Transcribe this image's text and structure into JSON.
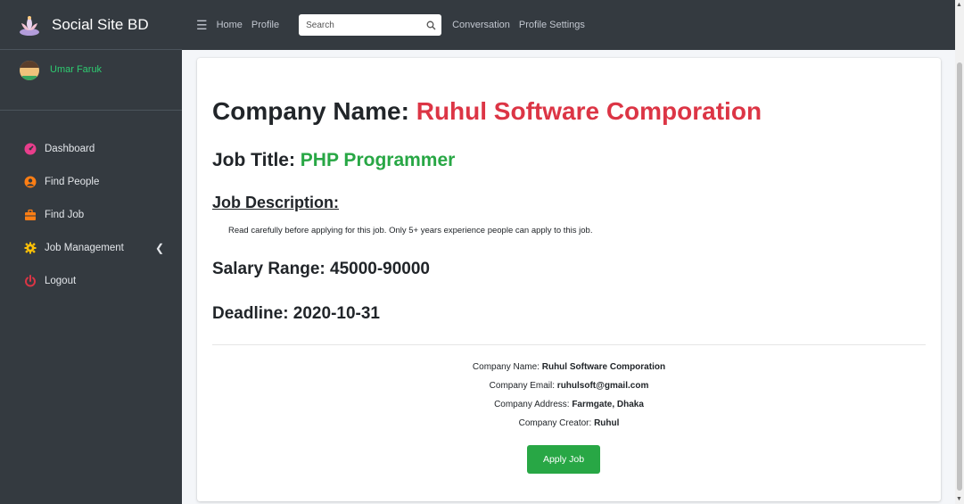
{
  "brand": {
    "title": "Social Site BD",
    "logo_icon": "lotus-logo-icon"
  },
  "user": {
    "name": "Umar Faruk"
  },
  "sidebar": {
    "items": [
      {
        "label": "Dashboard",
        "icon": "dashboard-icon",
        "color": "#e83e8c"
      },
      {
        "label": "Find People",
        "icon": "user-icon",
        "color": "#fd7e14"
      },
      {
        "label": "Find Job",
        "icon": "briefcase-icon",
        "color": "#fd7e14"
      },
      {
        "label": "Job Management",
        "icon": "gear-icon",
        "color": "#ffc107",
        "has_submenu": true
      },
      {
        "label": "Logout",
        "icon": "power-icon",
        "color": "#dc3545"
      }
    ]
  },
  "topbar": {
    "home_label": "Home",
    "profile_label": "Profile",
    "search_placeholder": "Search",
    "conversation_label": "Conversation",
    "profile_settings_label": "Profile Settings"
  },
  "job": {
    "company_label": "Company Name: ",
    "company_name": "Ruhul Software Comporation",
    "title_label": "Job Title: ",
    "title": "PHP Programmer",
    "description_heading": "Job Description:",
    "description": "Read carefully before applying for this job. Only 5+ years experience people can apply to this job.",
    "salary": "Salary Range: 45000-90000",
    "deadline": "Deadline: 2020-10-31"
  },
  "company_info": {
    "name_label": "Company Name: ",
    "name": "Ruhul Software Comporation",
    "email_label": "Company Email: ",
    "email": "ruhulsoft@gmail.com",
    "address_label": "Company Address: ",
    "address": "Farmgate, Dhaka",
    "creator_label": "Company Creator: ",
    "creator": "Ruhul"
  },
  "apply_button_label": "Apply Job",
  "colors": {
    "sidebar_bg": "#343a40",
    "company_accent": "#dc3545",
    "title_accent": "#28a745",
    "button": "#28a745"
  }
}
